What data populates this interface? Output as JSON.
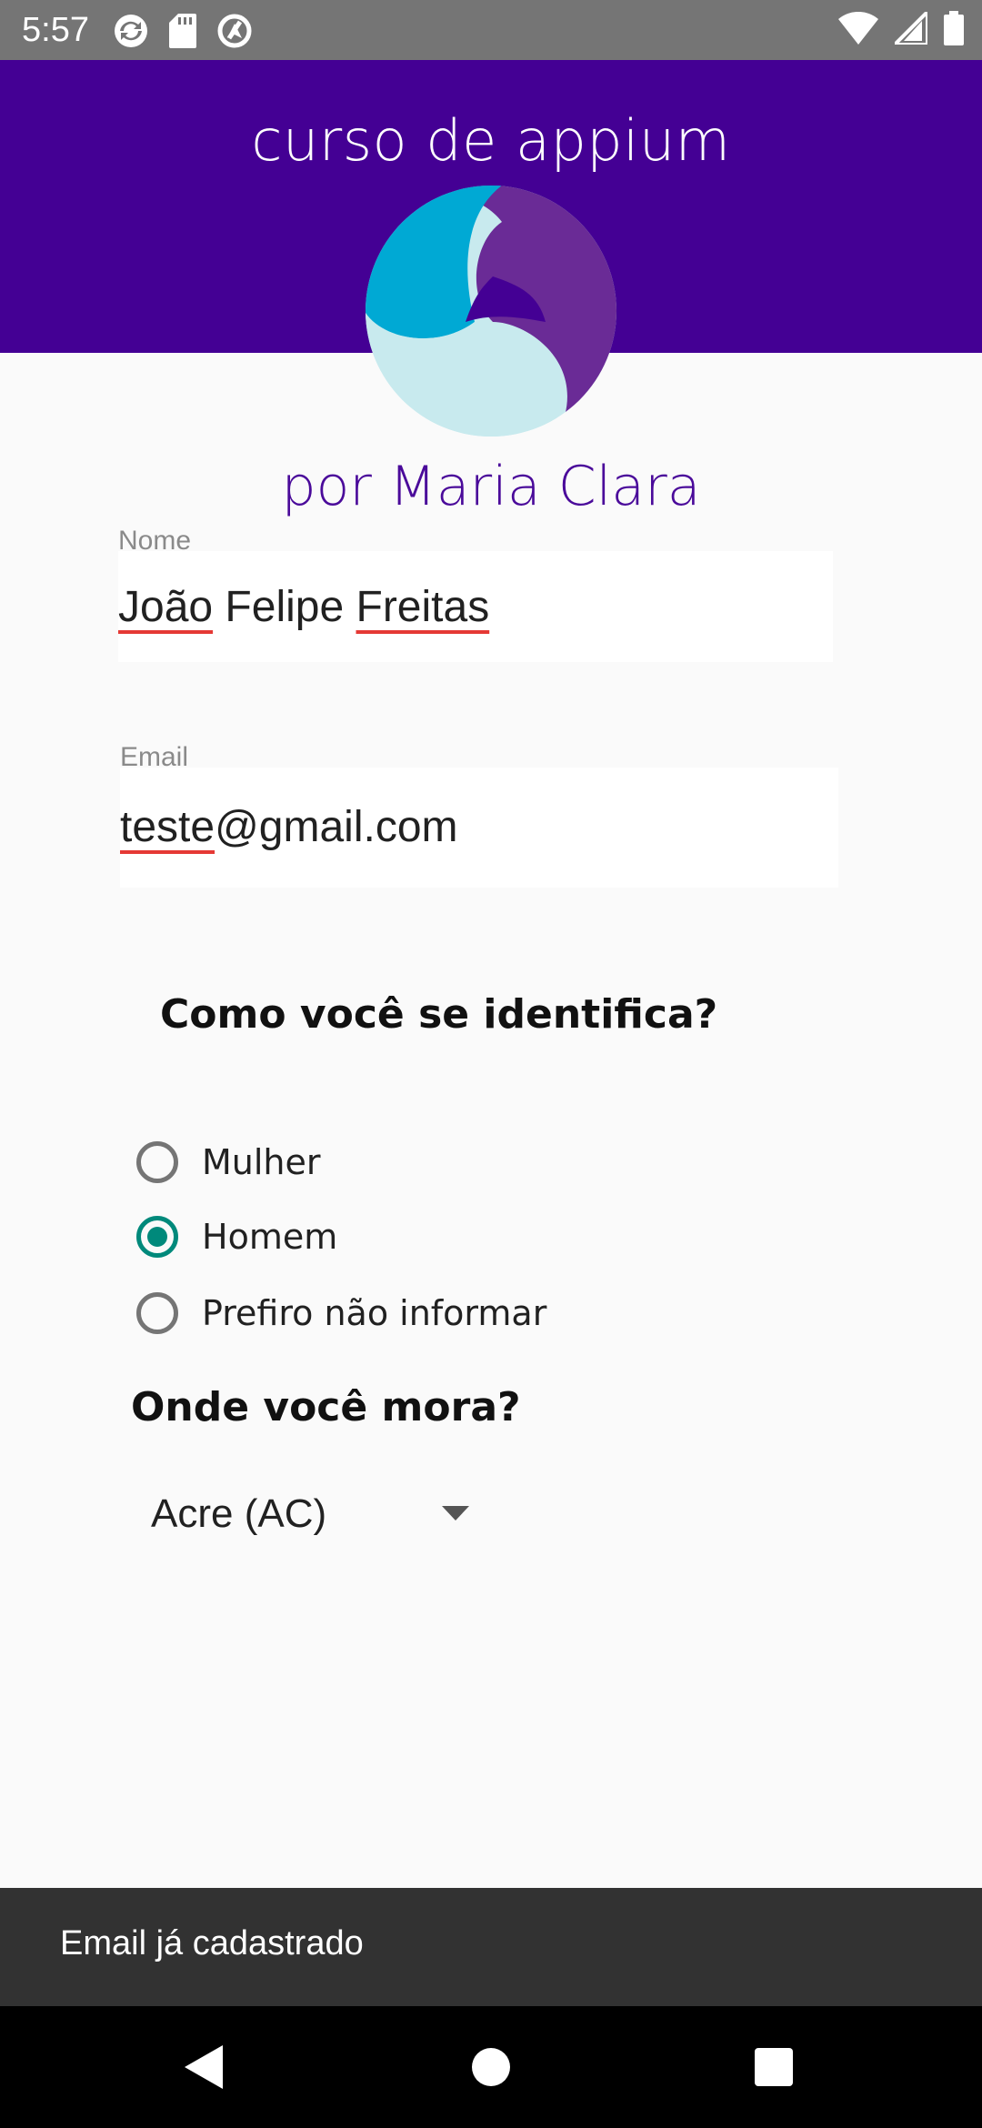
{
  "status_bar": {
    "time": "5:57",
    "icons_left": [
      "sync-icon",
      "sd-card-icon",
      "no-location-icon"
    ],
    "icons_right": [
      "wifi-icon",
      "signal-icon",
      "battery-icon"
    ]
  },
  "header": {
    "title": "curso de appium",
    "subtitle": "por Maria Clara",
    "background": "#440094"
  },
  "form": {
    "name": {
      "label": "Nome",
      "value_parts": [
        "João",
        " Felipe ",
        "Freitas"
      ]
    },
    "email": {
      "label": "Email",
      "value_parts": [
        "teste",
        "@gmail.com"
      ]
    },
    "gender": {
      "question": "Como você se identifica?",
      "options": [
        {
          "label": "Mulher",
          "checked": false
        },
        {
          "label": "Homem",
          "checked": true
        },
        {
          "label": "Prefiro não informar",
          "checked": false
        }
      ]
    },
    "location": {
      "question": "Onde você mora?",
      "selected": "Acre (AC)"
    }
  },
  "snackbar": {
    "message": "Email já cadastrado"
  },
  "nav": {
    "buttons": [
      "back-icon",
      "home-icon",
      "recents-icon"
    ]
  },
  "colors": {
    "accent": "#00897b",
    "header": "#440094",
    "snackbar": "#323232"
  }
}
